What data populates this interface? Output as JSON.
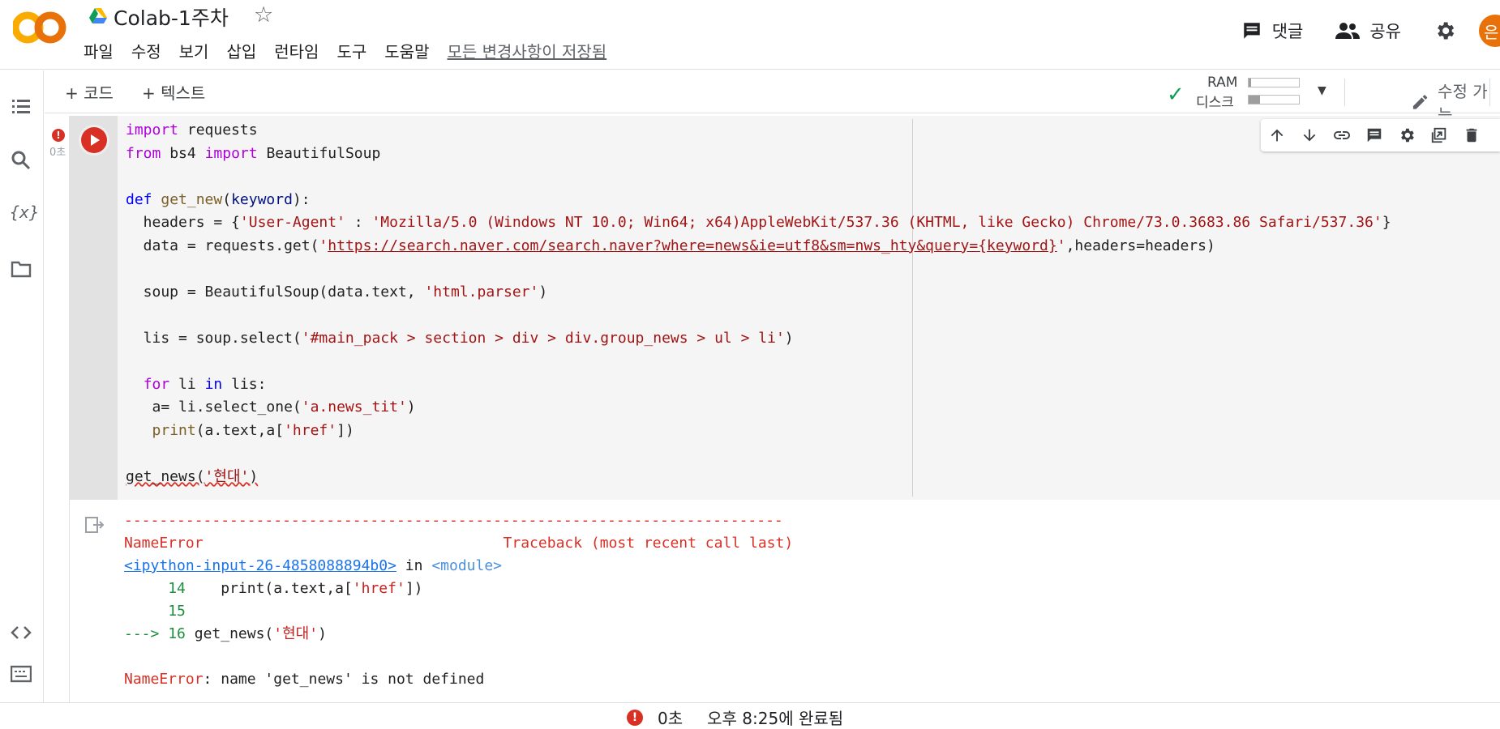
{
  "header": {
    "doc_title": "Colab-1주차",
    "logo_text": "CO",
    "menu": [
      "파일",
      "수정",
      "보기",
      "삽입",
      "런타임",
      "도구",
      "도움말"
    ],
    "saved_status": "모든 변경사항이 저장됨",
    "comment_label": "댓글",
    "share_label": "공유",
    "avatar_initial": "은"
  },
  "toolbar": {
    "add_code": "+ 코드",
    "add_text": "+ 텍스트",
    "ram_label": "RAM",
    "disk_label": "디스크",
    "ram_usage": 0.05,
    "disk_usage": 0.22,
    "edit_mode": "수정 가능"
  },
  "cell": {
    "exec_time": "0초",
    "code_lines": [
      "import requests",
      "from bs4 import BeautifulSoup",
      "",
      "def get_new(keyword):",
      "  headers = {'User-Agent' : 'Mozilla/5.0 (Windows NT 10.0; Win64; x64)AppleWebKit/537.36 (KHTML, like Gecko) Chrome/73.0.3683.86 Safari/537.36'}",
      "  data = requests.get('https://search.naver.com/search.naver?where=news&ie=utf8&sm=nws_hty&query={keyword}',headers=headers)",
      "",
      "  soup = BeautifulSoup(data.text, 'html.parser')",
      "",
      "  lis = soup.select('#main_pack > section > div > div.group_news > ul > li')",
      "",
      "  for li in lis:",
      "   a= li.select_one('a.news_tit')",
      "   print(a.text,a['href'])",
      "",
      "get_news('현대')"
    ],
    "output": {
      "dashes": "---------------------------------------------------------------------------",
      "error_name": "NameError",
      "traceback_header": "Traceback (most recent call last)",
      "input_ref": "<ipython-input-26-4858088894b0>",
      "in_word": "in",
      "module": "<module>",
      "line14_no": "14",
      "line14_code": "print(a.text,a['href'])",
      "line15_no": "15",
      "arrow": "--->",
      "line16_no": "16",
      "line16_code": "get_news('현대')",
      "error_message": "name 'get_news' is not defined"
    }
  },
  "status": {
    "time": "0초",
    "completed": "오후 8:25에 완료됨"
  }
}
